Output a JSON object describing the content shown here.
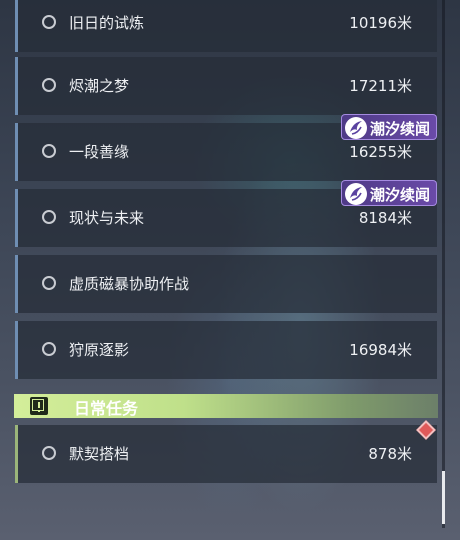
{
  "quests": [
    {
      "title": "旧日的试炼",
      "distance": "10196米",
      "tag": ""
    },
    {
      "title": "烬潮之梦",
      "distance": "17211米",
      "tag": ""
    },
    {
      "title": "一段善缘",
      "distance": "16255米",
      "tag": "潮汐续闻"
    },
    {
      "title": "现状与未来",
      "distance": "8184米",
      "tag": "潮汐续闻"
    },
    {
      "title": "虚质磁暴协助作战",
      "distance": "",
      "tag": ""
    },
    {
      "title": "狩原逐影",
      "distance": "16984米",
      "tag": ""
    }
  ],
  "daily_section": {
    "title": "日常任务",
    "icon": "alert-box-icon",
    "color": "#c8e690"
  },
  "daily_quests": [
    {
      "title": "默契搭档",
      "distance": "878米",
      "marker": "red-diamond-icon"
    }
  ],
  "colors": {
    "row_accent": "#6f8eb3",
    "daily_accent": "#9bb57a",
    "tag_bg": "#5a42a0"
  }
}
